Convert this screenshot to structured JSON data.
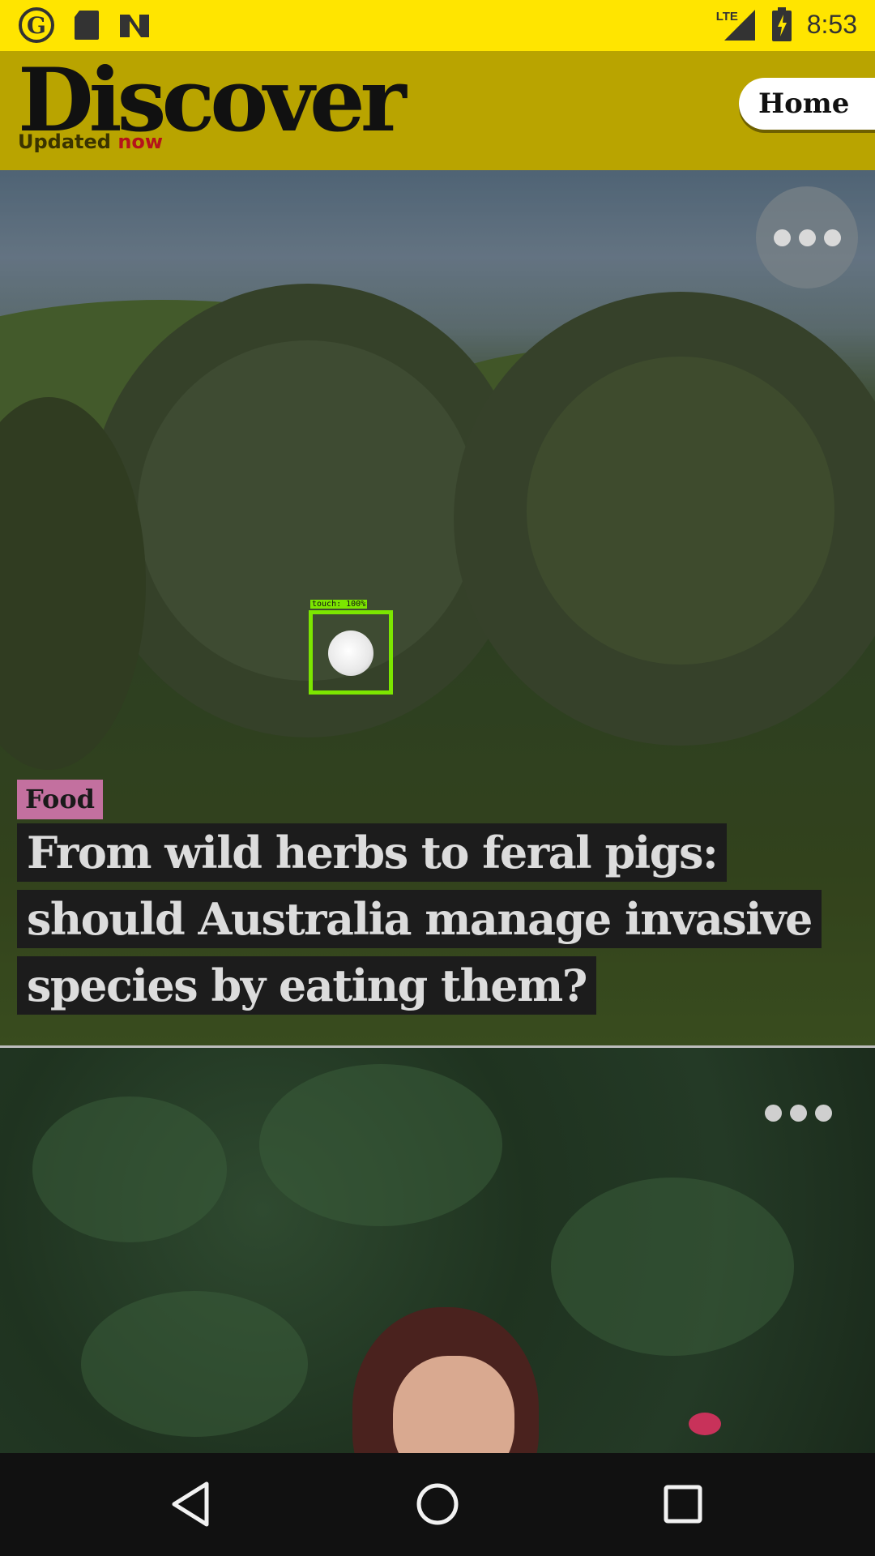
{
  "status_bar": {
    "left_icons": [
      "guardian-logo-icon",
      "sd-card-icon",
      "n-icon"
    ],
    "network": "LTE",
    "time": "8:53"
  },
  "header": {
    "title": "Discover",
    "updated_prefix": "Updated",
    "updated_suffix": "now",
    "home_button": "Home"
  },
  "cards": [
    {
      "kicker": "Food",
      "headline": "From wild herbs to feral pigs: should Australia manage invasive species by eating them?",
      "touch_label": "touch: 100%"
    },
    {}
  ],
  "nav_bar": {
    "buttons": [
      "back-icon",
      "home-icon",
      "recents-icon"
    ]
  },
  "colors": {
    "status_bar": "#ffe500",
    "header": "#b9a400",
    "kicker": "#c3709f",
    "updated_now": "#b5121b",
    "touch_box": "#7ce600"
  }
}
